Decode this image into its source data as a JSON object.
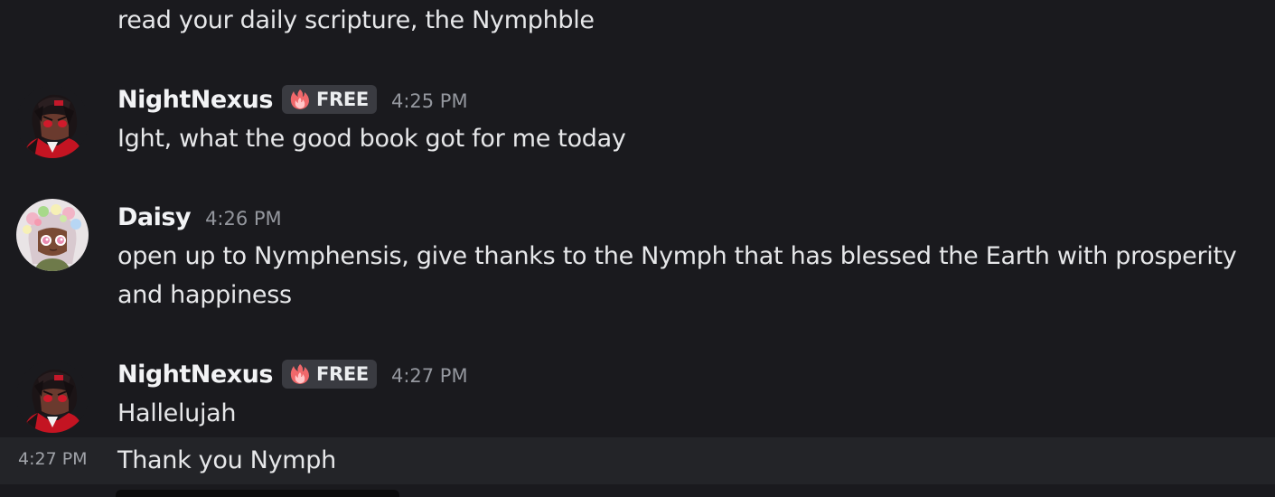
{
  "messages": {
    "continued": {
      "text": "read your daily scripture, the Nymphble"
    },
    "m1": {
      "username": "NightNexus",
      "tag_label": "FREE",
      "tag_icon": "flame-icon",
      "timestamp": "4:25 PM",
      "text": "Ight, what the good book got for me today"
    },
    "m2": {
      "username": "Daisy",
      "timestamp": "4:26 PM",
      "text_line1": "open up to Nymphensis, give thanks to the Nymph that has blessed the Earth with prosperity",
      "text_line2": "and happiness"
    },
    "m3": {
      "username": "NightNexus",
      "tag_label": "FREE",
      "tag_icon": "flame-icon",
      "timestamp": "4:27 PM",
      "text": "Hallelujah"
    },
    "m3_followup": {
      "timestamp": "4:27 PM",
      "text": "Thank you Nymph"
    }
  },
  "colors": {
    "background": "#1a1a1e",
    "hover_row": "#232428",
    "tag_background": "#3a3b41",
    "tag_flame": "#f0686b",
    "username": "#f2f3f5",
    "timestamp": "#94979e"
  }
}
